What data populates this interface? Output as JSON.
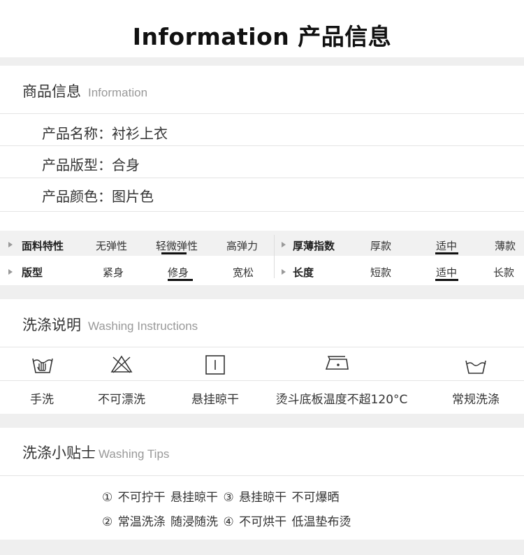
{
  "header": {
    "title": "Information 产品信息"
  },
  "product_info": {
    "heading_cn": "商品信息",
    "heading_en": "Information",
    "rows": [
      {
        "label": "产品名称：",
        "value": "衬衫上衣"
      },
      {
        "label": "产品版型：",
        "value": "合身"
      },
      {
        "label": "产品颜色：",
        "value": "图片色"
      }
    ]
  },
  "attributes": {
    "elasticity": {
      "label": "面料特性",
      "options": [
        "无弹性",
        "轻微弹性",
        "高弹力"
      ],
      "selected": "轻微弹性"
    },
    "thickness": {
      "label": "厚薄指数",
      "options": [
        "厚款",
        "适中",
        "薄款"
      ],
      "selected": "适中"
    },
    "fit": {
      "label": "版型",
      "options": [
        "紧身",
        "修身",
        "宽松"
      ],
      "selected": "修身"
    },
    "length": {
      "label": "长度",
      "options": [
        "短款",
        "适中",
        "长款"
      ],
      "selected": "适中"
    }
  },
  "washing": {
    "heading_cn": "洗涤说明",
    "heading_en": "Washing Instructions",
    "items": [
      {
        "icon": "hand-wash-icon",
        "label": "手洗"
      },
      {
        "icon": "no-bleach-icon",
        "label": "不可漂洗"
      },
      {
        "icon": "hang-dry-icon",
        "label": "悬挂晾干"
      },
      {
        "icon": "iron-icon",
        "label": "烫斗底板温度不超120°C"
      },
      {
        "icon": "wash-tub-icon",
        "label": "常规洗涤"
      }
    ]
  },
  "tips": {
    "heading_cn": "洗涤小贴士",
    "heading_en": "Washing Tips",
    "lines": [
      "① 不可拧干  悬挂晾干  ③ 悬挂晾干  不可爆晒",
      "② 常温洗涤  随浸随洗  ④ 不可烘干  低温垫布烫"
    ]
  }
}
